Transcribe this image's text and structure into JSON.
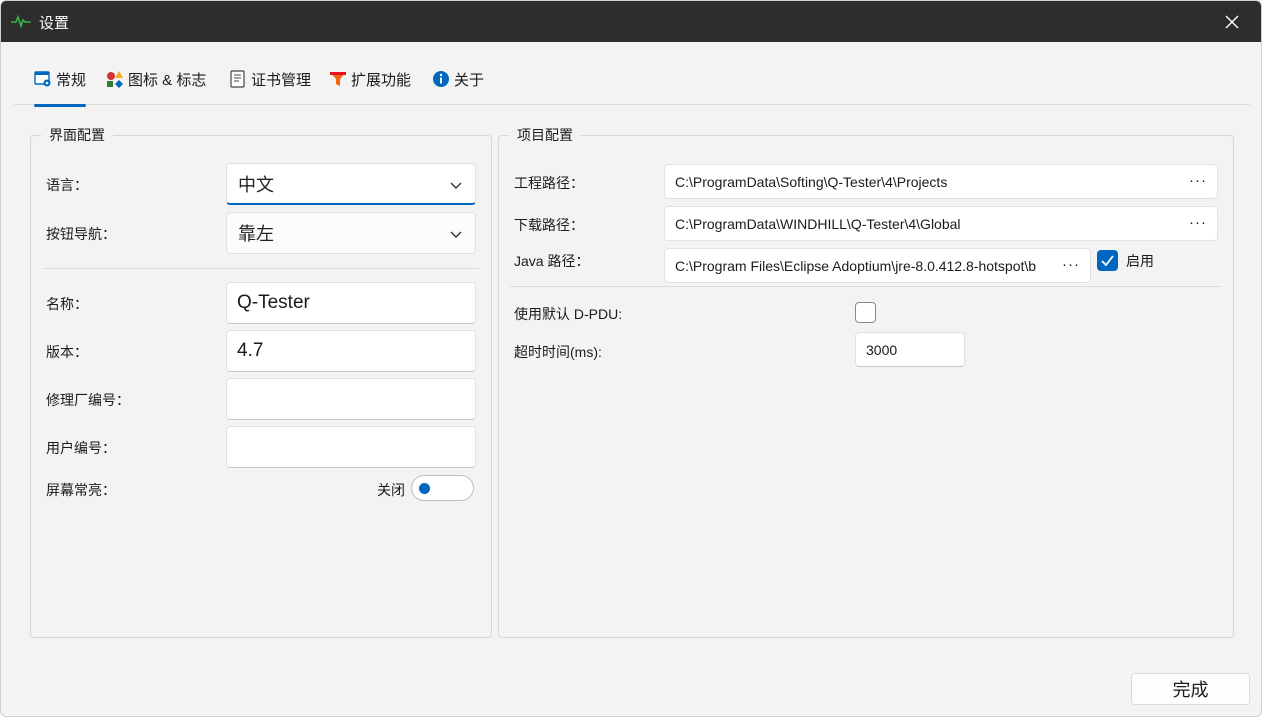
{
  "window": {
    "title": "设置",
    "app_icon": "pulse-wave-icon",
    "close_icon": "close-icon"
  },
  "tabs": [
    {
      "label": "常规",
      "icon": "window-gear-icon",
      "active": true
    },
    {
      "label": "图标 & 标志",
      "icon": "shapes-icon",
      "active": false
    },
    {
      "label": "证书管理",
      "icon": "certificate-document-icon",
      "active": false
    },
    {
      "label": "扩展功能",
      "icon": "funnel-icon",
      "active": false
    },
    {
      "label": "关于",
      "icon": "info-icon",
      "active": false
    }
  ],
  "ui_group": {
    "title": "界面配置",
    "language": {
      "label": "语言：",
      "value": "中文"
    },
    "button_nav": {
      "label": "按钮导航：",
      "value": "靠左"
    },
    "name": {
      "label": "名称：",
      "value": "Q-Tester"
    },
    "version": {
      "label": "版本：",
      "value": "4.7"
    },
    "repair_shop_no": {
      "label": "修理厂编号：",
      "value": ""
    },
    "user_no": {
      "label": "用户编号：",
      "value": ""
    },
    "screen_on": {
      "label": "屏幕常亮：",
      "state_label": "关闭",
      "on": false
    }
  },
  "project_group": {
    "title": "项目配置",
    "project_path": {
      "label": "工程路径：",
      "value": "C:\\ProgramData\\Softing\\Q-Tester\\4\\Projects"
    },
    "download_path": {
      "label": "下载路径：",
      "value": "C:\\ProgramData\\WINDHILL\\Q-Tester\\4\\Global"
    },
    "java_path": {
      "label": "Java 路径：",
      "value": "C:\\Program Files\\Eclipse Adoptium\\jre-8.0.412.8-hotspot\\b",
      "enable_label": "启用",
      "enabled": true
    },
    "browse_label": "···",
    "default_dpdu": {
      "label": "使用默认 D-PDU:",
      "checked": false
    },
    "timeout": {
      "label": "超时时间(ms):",
      "value": "3000"
    }
  },
  "footer": {
    "done_label": "完成"
  },
  "colors": {
    "accent": "#0067c0",
    "titlebar": "#2d2d2d",
    "background": "#f3f3f3"
  }
}
